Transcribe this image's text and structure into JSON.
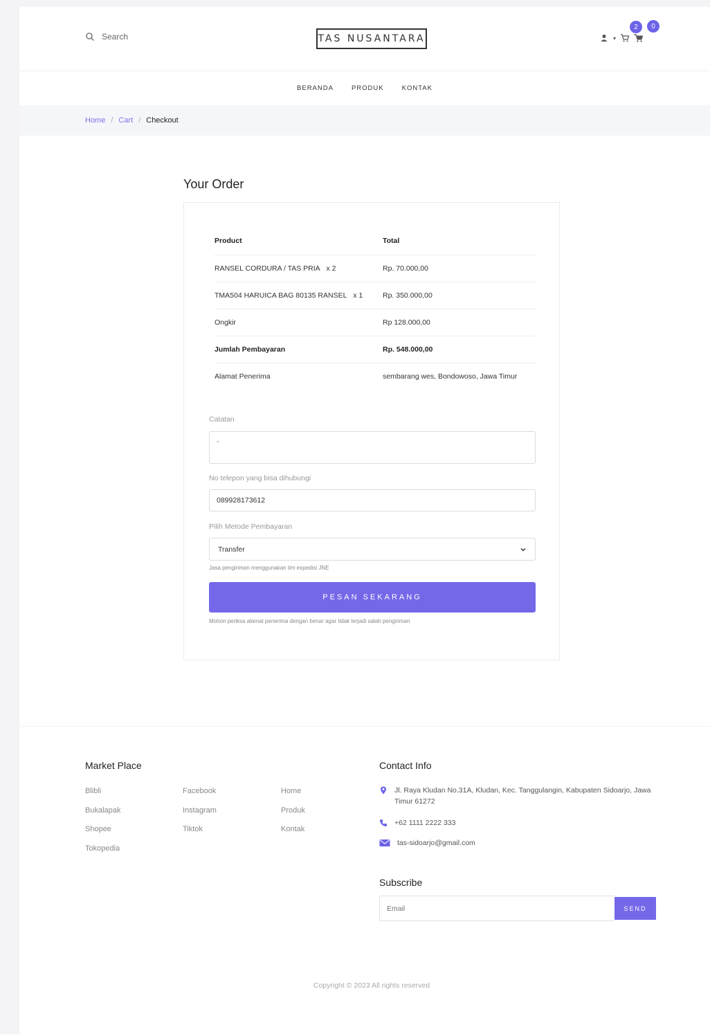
{
  "header": {
    "search_label": "Search",
    "logo": "TAS NUSANTARA",
    "cart_badge_1": "2",
    "cart_badge_2": "0"
  },
  "nav": {
    "items": [
      {
        "label": "BERANDA"
      },
      {
        "label": "PRODUK"
      },
      {
        "label": "KONTAK"
      }
    ]
  },
  "breadcrumb": {
    "home": "Home",
    "cart": "Cart",
    "current": "Checkout",
    "separator": "/"
  },
  "order": {
    "title": "Your Order",
    "columns": {
      "product": "Product",
      "total": "Total"
    },
    "items": [
      {
        "product": "RANSEL CORDURA / TAS PRIA",
        "qty": "x  2",
        "total": "Rp. 70.000,00"
      },
      {
        "product": "TMA504 HARUICA BAG 80135 RANSEL",
        "qty": "x  1",
        "total": "Rp. 350.000,00"
      }
    ],
    "shipping": {
      "label": "Ongkir",
      "value": "Rp 128.000,00"
    },
    "grand_total": {
      "label": "Jumlah Pembayaran",
      "value": "Rp. 548.000,00"
    },
    "address": {
      "label": "Alamat Penerima",
      "value": "sembarang wes, Bondowoso, Jawa Timur"
    }
  },
  "form": {
    "notes_label": "Catatan",
    "notes_value": "-",
    "phone_label": "No telepon yang bisa dihubungi",
    "phone_value": "089928173612",
    "payment_label": "Pilih Metode Pembayaran",
    "payment_value": "Transfer",
    "shipping_hint": "Jasa pengiriman menggunakan tim expedisi JNE",
    "submit_label": "PESAN SEKARANG",
    "submit_hint": "Mohon periksa alamat penerima dengan benar agar tidak terjadi salah pengiriman"
  },
  "footer": {
    "marketplace_heading": "Market Place",
    "marketplaces": [
      "Blibli",
      "Bukalapak",
      "Shopee",
      "Tokopedia"
    ],
    "socials": [
      "Facebook",
      "Instagram",
      "Tiktok"
    ],
    "pages": [
      "Home",
      "Produk",
      "Kontak"
    ],
    "contact_heading": "Contact Info",
    "address": "Jl. Raya Kludan No.31A, Kludan, Kec. Tanggulangin, Kabupaten Sidoarjo, Jawa Timur 61272",
    "phone": "+62 1111 2222 333",
    "email": "tas-sidoarjo@gmail.com",
    "subscribe_heading": "Subscribe",
    "email_placeholder": "Email",
    "send_label": "SEND",
    "copyright": "Copyright © 2023 All rights reserved"
  },
  "colors": {
    "accent": "#7568e8",
    "badge": "#6c63e8",
    "link": "#7c74e8"
  }
}
